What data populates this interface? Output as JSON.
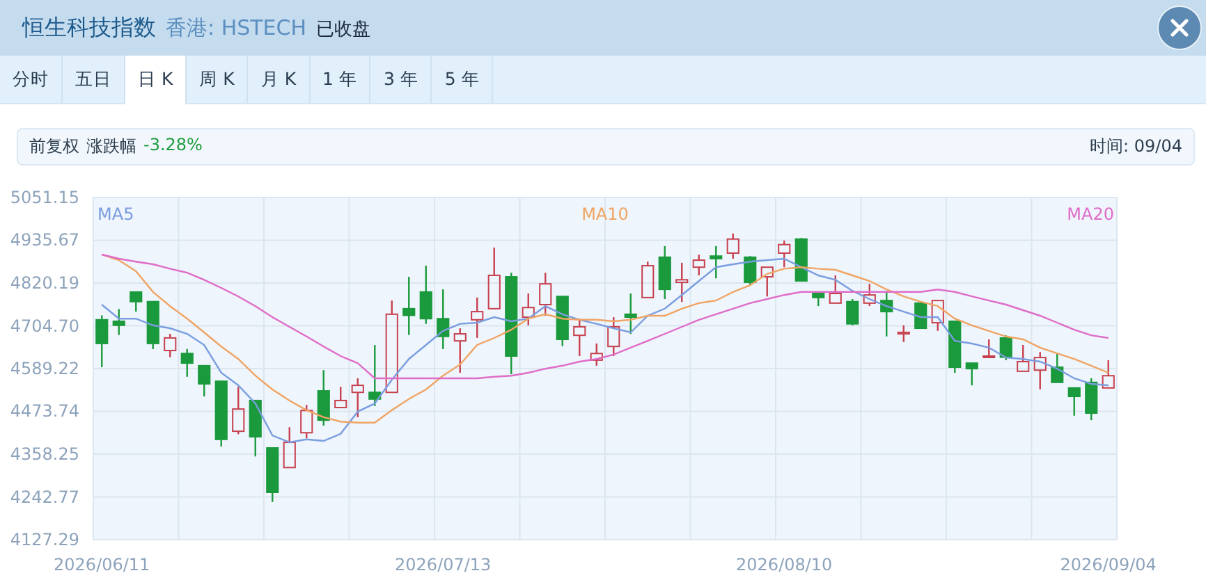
{
  "header": {
    "title": "恒生科技指数",
    "market": "香港: HSTECH",
    "status": "已收盘"
  },
  "tabs": [
    {
      "label": "分时",
      "selected": false
    },
    {
      "label": "五日",
      "selected": false
    },
    {
      "label": "日 K",
      "selected": true
    },
    {
      "label": "周 K",
      "selected": false
    },
    {
      "label": "月 K",
      "selected": false
    },
    {
      "label": "1 年",
      "selected": false
    },
    {
      "label": "3 年",
      "selected": false
    },
    {
      "label": "5 年",
      "selected": false
    }
  ],
  "info_bar": {
    "adjust_label": "前复权",
    "change_label": "涨跌幅",
    "change_value": "-3.28%",
    "time_label": "时间: 09/04"
  },
  "chart": {
    "chart_data": {
      "type": "candlestick",
      "grid": true,
      "categories": [
        "2026/06/11",
        null,
        null,
        null,
        null,
        null,
        null,
        null,
        null,
        null,
        null,
        null,
        null,
        null,
        null,
        null,
        null,
        null,
        null,
        null,
        "2026/07/13",
        null,
        null,
        null,
        null,
        null,
        null,
        null,
        null,
        null,
        null,
        null,
        null,
        null,
        null,
        null,
        null,
        null,
        null,
        null,
        "2026/08/10",
        null,
        null,
        null,
        null,
        null,
        null,
        null,
        null,
        null,
        null,
        null,
        null,
        null,
        null,
        null,
        null,
        null,
        null,
        "2026/09/04"
      ],
      "ylim": [
        4127.29,
        5051.15
      ],
      "yticks": [
        5051.15,
        4935.67,
        4820.19,
        {
          "value": 4704.7,
          "label": "4704.70"
        },
        4589.22,
        4473.74,
        4358.25,
        4242.77,
        4127.29
      ],
      "series": [
        {
          "name": "MA5",
          "type": "line",
          "color": "#7a9de0",
          "values": [
            4762,
            4724,
            4724,
            4706,
            4698,
            4683,
            4653,
            4578,
            4544,
            4495,
            4409,
            4390,
            4398,
            4394,
            4413,
            4473,
            4495,
            4559,
            4615,
            4653,
            4691,
            4710,
            4713,
            4728,
            4717,
            4724,
            4758,
            4736,
            4721,
            4710,
            4698,
            4687,
            4732,
            4751,
            4788,
            4826,
            4863,
            4871,
            4878,
            4882,
            4886,
            4863,
            4841,
            4829,
            4799,
            4777,
            4758,
            4743,
            4728,
            4728,
            4664,
            4657,
            4646,
            4619,
            4615,
            4608,
            4589,
            4563,
            4548,
            4544
          ]
        },
        {
          "name": "MA10",
          "type": "line",
          "color": "#f0a464",
          "values": [
            4897,
            4882,
            4852,
            4796,
            4758,
            4724,
            4687,
            4649,
            4615,
            4570,
            4533,
            4503,
            4477,
            4458,
            4446,
            4443,
            4443,
            4477,
            4507,
            4533,
            4570,
            4600,
            4653,
            4672,
            4694,
            4724,
            4736,
            4724,
            4721,
            4721,
            4717,
            4721,
            4732,
            4732,
            4751,
            4766,
            4773,
            4796,
            4814,
            4845,
            4859,
            4863,
            4859,
            4856,
            4841,
            4826,
            4803,
            4784,
            4770,
            4758,
            4724,
            4706,
            4691,
            4676,
            4668,
            4646,
            4630,
            4615,
            4597,
            4578
          ]
        },
        {
          "name": "MA20",
          "type": "line",
          "color": "#e06cc8",
          "values": [
            4897,
            4886,
            4878,
            4871,
            4859,
            4848,
            4829,
            4807,
            4784,
            4758,
            4728,
            4702,
            4676,
            4649,
            4623,
            4604,
            4563,
            4563,
            4563,
            4563,
            4563,
            4563,
            4563,
            4567,
            4570,
            4578,
            4589,
            4597,
            4608,
            4615,
            4627,
            4646,
            4664,
            4683,
            4702,
            4721,
            4736,
            4751,
            4766,
            4777,
            4788,
            4796,
            4796,
            4796,
            4796,
            4796,
            4796,
            4796,
            4796,
            4803,
            4796,
            4784,
            4773,
            4762,
            4747,
            4732,
            4713,
            4694,
            4679,
            4672
          ]
        }
      ],
      "ohlc": [
        [
          4721,
          4733,
          4593,
          4657
        ],
        [
          4717,
          4750,
          4680,
          4706
        ],
        [
          4796,
          4796,
          4743,
          4770
        ],
        [
          4770,
          4770,
          4642,
          4657
        ],
        [
          4638,
          4683,
          4620,
          4672
        ],
        [
          4630,
          4642,
          4567,
          4604
        ],
        [
          4597,
          4597,
          4514,
          4548
        ],
        [
          4555,
          4555,
          4379,
          4398
        ],
        [
          4420,
          4540,
          4412,
          4480
        ],
        [
          4503,
          4503,
          4352,
          4405
        ],
        [
          4375,
          4375,
          4229,
          4255
        ],
        [
          4322,
          4431,
          4322,
          4390
        ],
        [
          4416,
          4491,
          4401,
          4476
        ],
        [
          4529,
          4585,
          4435,
          4450
        ],
        [
          4484,
          4540,
          4484,
          4503
        ],
        [
          4525,
          4563,
          4458,
          4544
        ],
        [
          4525,
          4653,
          4488,
          4507
        ],
        [
          4525,
          4773,
          4525,
          4736
        ],
        [
          4751,
          4837,
          4680,
          4733
        ],
        [
          4796,
          4867,
          4710,
          4724
        ],
        [
          4724,
          4803,
          4642,
          4676
        ],
        [
          4664,
          4698,
          4578,
          4683
        ],
        [
          4721,
          4781,
          4672,
          4743
        ],
        [
          4751,
          4916,
          4751,
          4841
        ],
        [
          4837,
          4848,
          4574,
          4623
        ],
        [
          4728,
          4792,
          4706,
          4754
        ],
        [
          4762,
          4848,
          4732,
          4818
        ],
        [
          4784,
          4784,
          4650,
          4668
        ],
        [
          4679,
          4724,
          4623,
          4702
        ],
        [
          4612,
          4657,
          4597,
          4630
        ],
        [
          4649,
          4728,
          4623,
          4702
        ],
        [
          4736,
          4792,
          4683,
          4728
        ],
        [
          4781,
          4878,
          4781,
          4867
        ],
        [
          4890,
          4920,
          4777,
          4803
        ],
        [
          4822,
          4875,
          4769,
          4829
        ],
        [
          4863,
          4897,
          4841,
          4882
        ],
        [
          4893,
          4920,
          4833,
          4886
        ],
        [
          4901,
          4954,
          4886,
          4939
        ],
        [
          4890,
          4893,
          4815,
          4822
        ],
        [
          4837,
          4863,
          4784,
          4863
        ],
        [
          4901,
          4935,
          4863,
          4924
        ],
        [
          4939,
          4942,
          4826,
          4826
        ],
        [
          4792,
          4792,
          4758,
          4781
        ],
        [
          4766,
          4841,
          4766,
          4792
        ],
        [
          4770,
          4777,
          4706,
          4710
        ],
        [
          4766,
          4818,
          4758,
          4788
        ],
        [
          4773,
          4799,
          4676,
          4743
        ],
        [
          4683,
          4706,
          4661,
          4687
        ],
        [
          4766,
          4766,
          4698,
          4698
        ],
        [
          4713,
          4773,
          4691,
          4773
        ],
        [
          4717,
          4717,
          4578,
          4593
        ],
        [
          4604,
          4604,
          4544,
          4589
        ],
        [
          4620,
          4668,
          4618,
          4623
        ],
        [
          4672,
          4679,
          4612,
          4620
        ],
        [
          4582,
          4653,
          4582,
          4608
        ],
        [
          4585,
          4634,
          4533,
          4619
        ],
        [
          4593,
          4630,
          4552,
          4552
        ],
        [
          4537,
          4537,
          4462,
          4514
        ],
        [
          4552,
          4563,
          4450,
          4469
        ],
        [
          4537,
          4612,
          4537,
          4570
        ]
      ]
    }
  }
}
